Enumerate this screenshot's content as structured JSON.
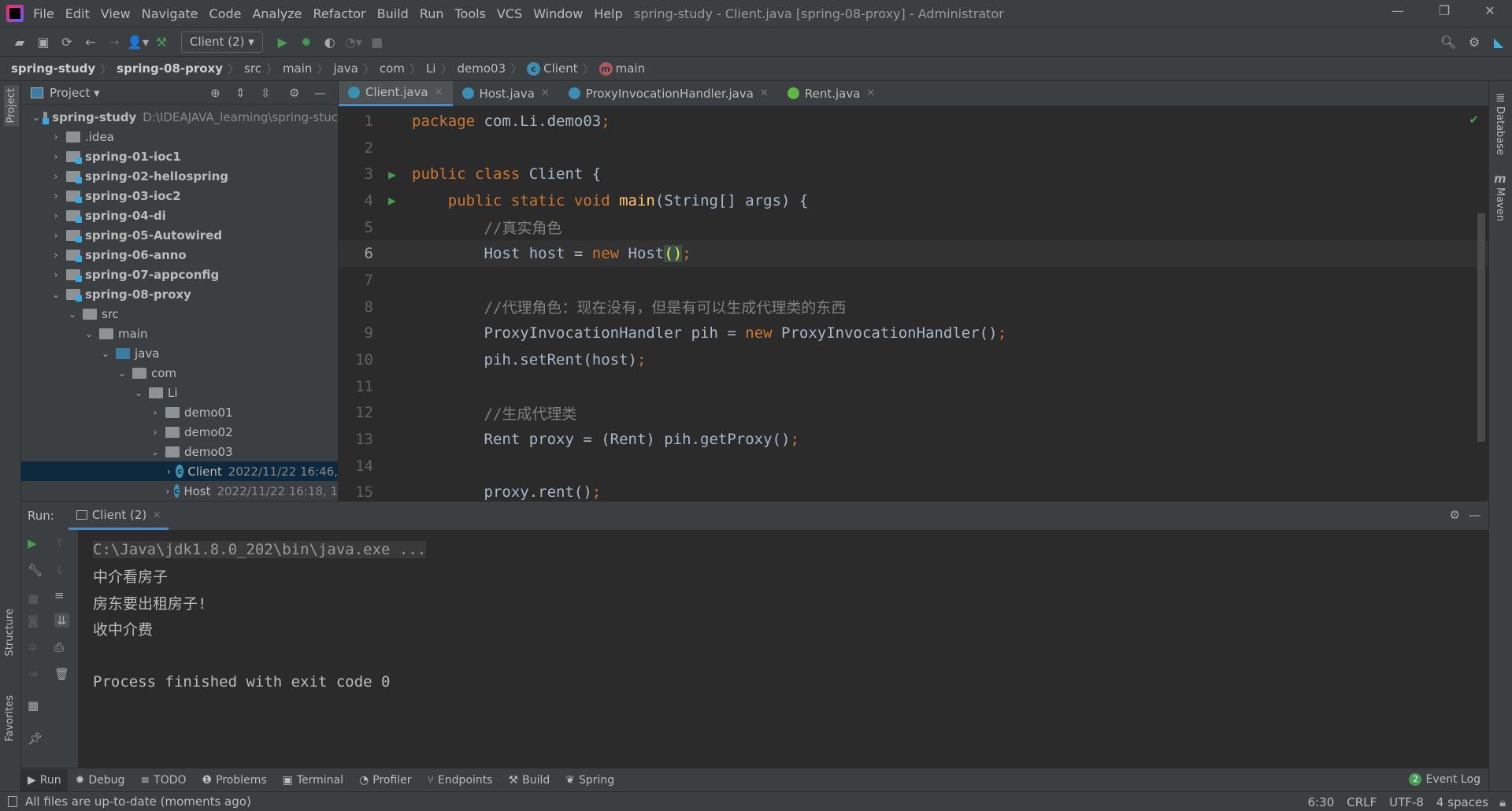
{
  "window": {
    "title": "spring-study - Client.java [spring-08-proxy] - Administrator"
  },
  "menu": [
    "File",
    "Edit",
    "View",
    "Navigate",
    "Code",
    "Analyze",
    "Refactor",
    "Build",
    "Run",
    "Tools",
    "VCS",
    "Window",
    "Help"
  ],
  "toolbar": {
    "run_config": "Client (2)"
  },
  "breadcrumb": [
    "spring-study",
    "spring-08-proxy",
    "src",
    "main",
    "java",
    "com",
    "Li",
    "demo03",
    "Client",
    "main"
  ],
  "project": {
    "title": "Project",
    "tree": [
      {
        "label": "spring-study",
        "extra": "D:\\IDEAJAVA_learning\\spring-stuc",
        "depth": 0,
        "open": true,
        "type": "module",
        "bold": true
      },
      {
        "label": ".idea",
        "depth": 1,
        "open": false,
        "type": "folder"
      },
      {
        "label": "spring-01-ioc1",
        "depth": 1,
        "open": false,
        "type": "module",
        "bold": true
      },
      {
        "label": "spring-02-hellospring",
        "depth": 1,
        "open": false,
        "type": "module",
        "bold": true
      },
      {
        "label": "spring-03-ioc2",
        "depth": 1,
        "open": false,
        "type": "module",
        "bold": true
      },
      {
        "label": "spring-04-di",
        "depth": 1,
        "open": false,
        "type": "module",
        "bold": true
      },
      {
        "label": "spring-05-Autowired",
        "depth": 1,
        "open": false,
        "type": "module",
        "bold": true
      },
      {
        "label": "spring-06-anno",
        "depth": 1,
        "open": false,
        "type": "module",
        "bold": true
      },
      {
        "label": "spring-07-appconfig",
        "depth": 1,
        "open": false,
        "type": "module",
        "bold": true
      },
      {
        "label": "spring-08-proxy",
        "depth": 1,
        "open": true,
        "type": "module",
        "bold": true
      },
      {
        "label": "src",
        "depth": 2,
        "open": true,
        "type": "folder"
      },
      {
        "label": "main",
        "depth": 3,
        "open": true,
        "type": "folder"
      },
      {
        "label": "java",
        "depth": 4,
        "open": true,
        "type": "src"
      },
      {
        "label": "com",
        "depth": 5,
        "open": true,
        "type": "package"
      },
      {
        "label": "Li",
        "depth": 6,
        "open": true,
        "type": "package"
      },
      {
        "label": "demo01",
        "depth": 7,
        "open": false,
        "type": "package"
      },
      {
        "label": "demo02",
        "depth": 7,
        "open": false,
        "type": "package"
      },
      {
        "label": "demo03",
        "depth": 7,
        "open": true,
        "type": "package"
      },
      {
        "label": "Client",
        "extra": "2022/11/22 16:46,",
        "depth": 8,
        "open": false,
        "type": "class",
        "selected": true
      },
      {
        "label": "Host",
        "extra": "2022/11/22 16:18, 1",
        "depth": 8,
        "open": false,
        "type": "class"
      }
    ]
  },
  "tabs": [
    {
      "label": "Client.java",
      "active": true,
      "icon": "class"
    },
    {
      "label": "Host.java",
      "icon": "class"
    },
    {
      "label": "ProxyInvocationHandler.java",
      "icon": "class"
    },
    {
      "label": "Rent.java",
      "icon": "interface"
    }
  ],
  "code": [
    {
      "n": "1",
      "html": "<span class='kw'>package </span>com.Li.demo03<span class='kw'>;</span>"
    },
    {
      "n": "2",
      "html": ""
    },
    {
      "n": "3",
      "run": true,
      "html": "<span class='kw'>public class </span>Client {"
    },
    {
      "n": "4",
      "run": true,
      "html": "    <span class='kw'>public static void </span><span class='fn'>main</span>(String[] args) {"
    },
    {
      "n": "5",
      "html": "        <span class='cm'>//真实角色</span>"
    },
    {
      "n": "6",
      "cur": true,
      "html": "        Host host = <span class='kw'>new </span>Host<span class='br'>()</span><span class='kw'>;</span>"
    },
    {
      "n": "7",
      "html": ""
    },
    {
      "n": "8",
      "html": "        <span class='cm'>//代理角色：现在没有，但是有可以生成代理类的东西</span>"
    },
    {
      "n": "9",
      "html": "        ProxyInvocationHandler pih = <span class='kw'>new </span>ProxyInvocationHandler()<span class='kw'>;</span>"
    },
    {
      "n": "10",
      "html": "        pih.setRent(host)<span class='kw'>;</span>"
    },
    {
      "n": "11",
      "html": ""
    },
    {
      "n": "12",
      "html": "        <span class='cm'>//生成代理类</span>"
    },
    {
      "n": "13",
      "html": "        Rent proxy = (Rent) pih.getProxy()<span class='kw'>;</span>"
    },
    {
      "n": "14",
      "html": ""
    },
    {
      "n": "15",
      "html": "        proxy.rent()<span class='kw'>;</span>"
    }
  ],
  "run": {
    "label": "Run:",
    "tab": "Client (2)",
    "output": [
      "C:\\Java\\jdk1.8.0_202\\bin\\java.exe ...",
      "中介看房子",
      "房东要出租房子!",
      "收中介费",
      "",
      "Process finished with exit code 0"
    ]
  },
  "bottom_tabs": [
    "Run",
    "Debug",
    "TODO",
    "Problems",
    "Terminal",
    "Profiler",
    "Endpoints",
    "Build",
    "Spring"
  ],
  "event_log": {
    "label": "Event Log",
    "count": "2"
  },
  "side": {
    "left": [
      "Project",
      "Structure",
      "Favorites"
    ],
    "right": [
      "Database",
      "Maven"
    ]
  },
  "status": {
    "message": "All files are up-to-date (moments ago)",
    "position": "6:30",
    "line_sep": "CRLF",
    "encoding": "UTF-8",
    "indent": "4 spaces"
  },
  "colors": {
    "keyword": "#cc7832",
    "comment": "#808080",
    "method": "#ffc66d",
    "accent": "#4a88c7",
    "run": "#499c54"
  }
}
